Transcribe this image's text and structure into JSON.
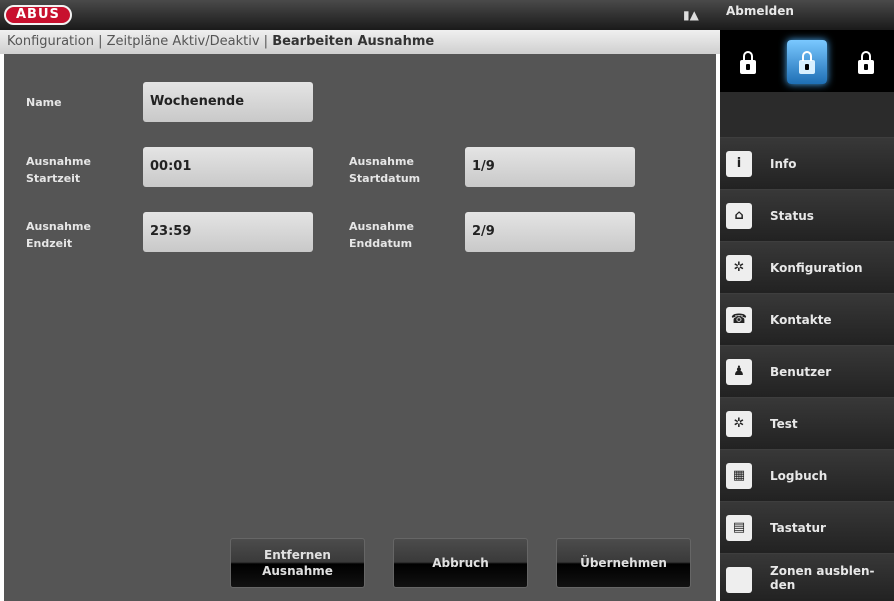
{
  "header": {
    "logo": "ABUS",
    "logout_label": "Abmelden"
  },
  "breadcrumb": {
    "path": "Konfiguration | Zeitpläne Aktiv/Deaktiv | ",
    "current": "Bearbeiten Ausnahme"
  },
  "form": {
    "name_label": "Name",
    "name_value": "Wochenende",
    "start_time_label_1": "Ausnahme",
    "start_time_label_2": "Startzeit",
    "start_time_value": "00:01",
    "start_date_label_1": "Ausnahme",
    "start_date_label_2": "Startdatum",
    "start_date_value": "1/9",
    "end_time_label_1": "Ausnahme",
    "end_time_label_2": "Endzeit",
    "end_time_value": "23:59",
    "end_date_label_1": "Ausnahme",
    "end_date_label_2": "Enddatum",
    "end_date_value": "2/9"
  },
  "buttons": {
    "remove_line1": "Entfernen",
    "remove_line2": "Ausnahme",
    "cancel": "Abbruch",
    "apply": "Übernehmen"
  },
  "modes": [
    {
      "icon": "lock-closed-icon",
      "active": false
    },
    {
      "icon": "lock-open-icon",
      "active": true
    },
    {
      "icon": "lock-closed-icon",
      "active": false
    }
  ],
  "nav": [
    {
      "label": "Info",
      "icon": "info-icon"
    },
    {
      "label": "Status",
      "icon": "home-icon"
    },
    {
      "label": "Konfiguration",
      "icon": "gears-icon"
    },
    {
      "label": "Kontakte",
      "icon": "contacts-icon"
    },
    {
      "label": "Benutzer",
      "icon": "user-icon"
    },
    {
      "label": "Test",
      "icon": "gears-icon"
    },
    {
      "label": "Logbuch",
      "icon": "calendar-icon"
    },
    {
      "label": "Tastatur",
      "icon": "keypad-icon"
    },
    {
      "label": "Zonen ausblen-den",
      "icon": "checkbox-icon"
    }
  ],
  "colors": {
    "brand": "#c8102e",
    "active_mode": "#1e6fb5",
    "panel": "#555555"
  }
}
